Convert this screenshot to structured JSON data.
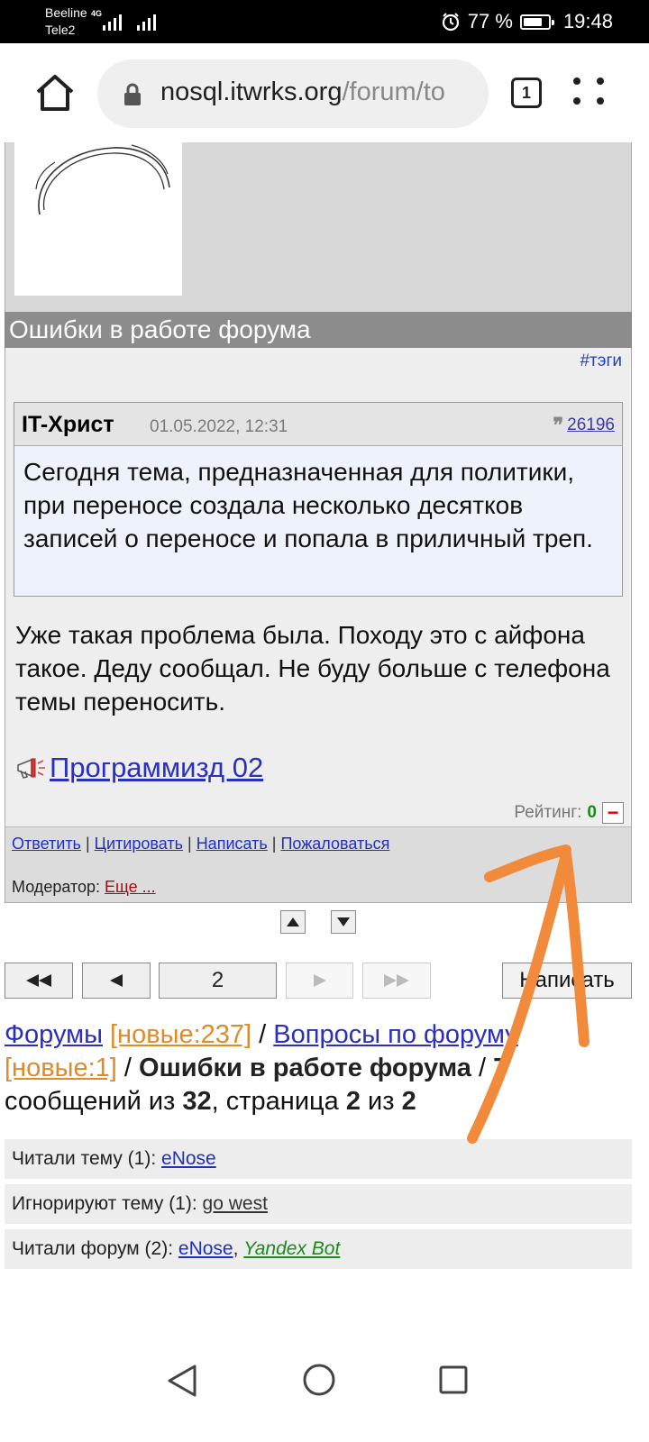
{
  "status_bar": {
    "carrier_1": "Beeline",
    "carrier_2": "Tele2",
    "network": "4G",
    "battery": "77 %",
    "battery_level": 0.77,
    "time": "19:48"
  },
  "browser": {
    "url_host": "nosql.itwrks.org",
    "url_path": "/forum/to",
    "tab_count": "1"
  },
  "post": {
    "topic_title": "Ошибки в работе форума",
    "tags_link": "#тэги",
    "quote_author": "IT-Христ",
    "quote_date": "01.05.2022, 12:31",
    "quote_id": "26196",
    "quote_text": "Сегодня тема, предназначенная для политики, при переносе создала несколько десятков записей о переносе и попала в приличный треп.",
    "reply_text": "Уже такая проблема была. Походу это с айфона такое. Деду сообщал. Не буду больше с телефона темы переносить.",
    "signature": "Программизд 02",
    "rating_label": "Рейтинг:",
    "rating_value": "0",
    "rating_minus": "−",
    "actions": [
      "Ответить",
      "Цитировать",
      "Написать",
      "Пожаловаться"
    ],
    "separator": "|",
    "moderator_label": "Модератор:",
    "moderator_link": "Еще ..."
  },
  "pager": {
    "current_page": "2",
    "write_button": "Написать"
  },
  "breadcrumbs": {
    "forums": "Форумы",
    "forums_new": "[новые:237]",
    "sep": "/",
    "section": "Вопросы по форуму",
    "section_new": "[новые:1]",
    "topic": "Ошибки в работе форума",
    "count_total_label": "7",
    "messages_of": "сообщений из",
    "total": "32",
    "page_label": ", страница",
    "page": "2",
    "of": "из",
    "pages": "2"
  },
  "info": {
    "readers_label": "Читали тему (1):",
    "readers": "eNose",
    "ignore_label": "Игнорируют тему (1):",
    "ignore": "go west",
    "forum_readers_label": "Читали форум (2):",
    "forum_reader_1": "eNose",
    "forum_reader_2": "Yandex Bot"
  },
  "colors": {
    "annotation_arrow": "#f28a3c",
    "link": "#2b2fbf",
    "new_badge": "#e08a2a",
    "rating_positive": "#1a8a1a"
  }
}
